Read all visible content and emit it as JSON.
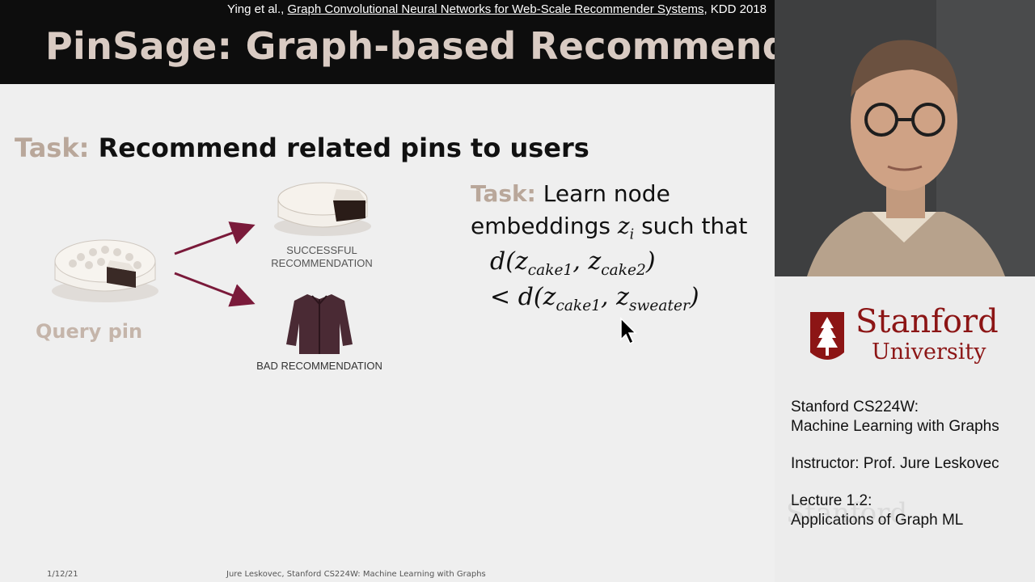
{
  "slide": {
    "citation": {
      "authors": "Ying et al., ",
      "paper_title": "Graph Convolutional Neural Networks for Web-Scale Recommender Systems",
      "venue": ", KDD 2018"
    },
    "title": "PinSage: Graph-based Recommender",
    "task_heading": {
      "prefix": "Task:",
      "text": " Recommend related pins to users"
    },
    "figure": {
      "query_label": "Query pin",
      "success_label_line1": "SUCCESSFUL",
      "success_label_line2": "RECOMMENDATION",
      "bad_label": "BAD RECOMMENDATION"
    },
    "right_task": {
      "prefix": "Task:",
      "line1": " Learn node",
      "line2a": "embeddings ",
      "z": "z",
      "z_sub": "i",
      "line2b": " such that"
    },
    "formula": {
      "d": "d",
      "z": "z",
      "sub_cake1": "cake1",
      "sub_cake2": "cake2",
      "sub_sweater": "sweater",
      "lt": "< "
    },
    "footer": {
      "date": "1/12/21",
      "credit": "Jure Leskovec, Stanford CS224W: Machine Learning with Graphs"
    }
  },
  "side_panel": {
    "logo": {
      "name": "Stanford",
      "sub": "University"
    },
    "course_line1": "Stanford CS224W:",
    "course_line2": "Machine Learning with Graphs",
    "instructor": "Instructor: Prof. Jure Leskovec",
    "lecture_line1": "Lecture 1.2:",
    "lecture_line2": "Applications of Graph ML",
    "watermark": "Stanford"
  },
  "colors": {
    "title_bar": "#0d0d0d",
    "title_text": "#d9cbc3",
    "accent_tan": "#b9a79a",
    "stanford_red": "#8c1515"
  }
}
